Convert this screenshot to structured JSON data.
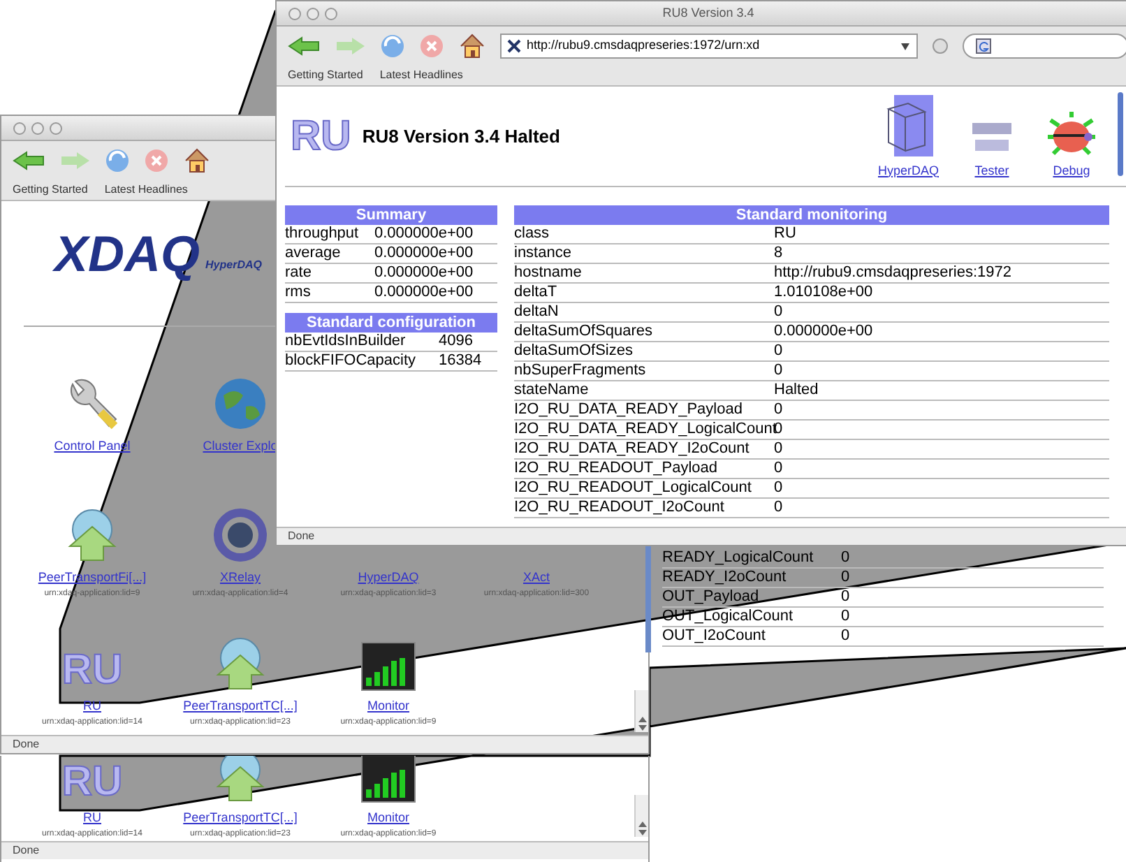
{
  "back_window": {
    "bookmarks": [
      "Getting Started",
      "Latest Headlines"
    ],
    "logo": "XDAQ",
    "logo_subtitle": "HyperDAQ",
    "application_rows": [
      [
        {
          "label": "Control Panel",
          "kind": "wrench"
        },
        {
          "label": "Cluster Explo",
          "kind": "globe"
        }
      ],
      [
        {
          "label": "PeerTransportFi[...]",
          "urn": "urn:xdaq-application:lid=9",
          "kind": "globe-arrow"
        },
        {
          "label": "XRelay",
          "urn": "urn:xdaq-application:lid=4",
          "kind": "ring"
        },
        {
          "label": "HyperDAQ",
          "urn": "urn:xdaq-application:lid=3",
          "kind": "hidden"
        },
        {
          "label": "XAct",
          "urn": "urn:xdaq-application:lid=300",
          "kind": "hidden"
        }
      ],
      [
        {
          "label": "RU",
          "urn": "urn:xdaq-application:lid=14",
          "kind": "ru",
          "icon_text": "RU"
        },
        {
          "label": "PeerTransportTC[...]",
          "urn": "urn:xdaq-application:lid=23",
          "kind": "globe-arrow"
        },
        {
          "label": "Monitor",
          "urn": "urn:xdaq-application:lid=9",
          "kind": "chart"
        }
      ]
    ],
    "status": "Done"
  },
  "lower_strip": {
    "applications": [
      {
        "label": "RU",
        "urn": "urn:xdaq-application:lid=14",
        "kind": "ru",
        "icon_text": "RU"
      },
      {
        "label": "PeerTransportTC[...]",
        "urn": "urn:xdaq-application:lid=23",
        "kind": "globe-arrow"
      },
      {
        "label": "Monitor",
        "urn": "urn:xdaq-application:lid=9",
        "kind": "chart"
      }
    ],
    "status": "Done"
  },
  "right_strip": {
    "rows": [
      {
        "name": "READY_LogicalCount",
        "value": "0"
      },
      {
        "name": "READY_I2oCount",
        "value": "0"
      },
      {
        "name": "OUT_Payload",
        "value": "0"
      },
      {
        "name": "OUT_LogicalCount",
        "value": "0"
      },
      {
        "name": "OUT_I2oCount",
        "value": "0"
      }
    ]
  },
  "front_window": {
    "title": "RU8 Version 3.4",
    "url": "http://rubu9.cmsdaqpreseries:1972/urn:xd",
    "bookmarks": [
      "Getting Started",
      "Latest Headlines"
    ],
    "logo": "RU",
    "heading": "RU8 Version 3.4 Halted",
    "tools": [
      {
        "label": "HyperDAQ",
        "kind": "cube"
      },
      {
        "label": "Tester",
        "kind": "tester"
      },
      {
        "label": "Debug",
        "kind": "bug"
      }
    ],
    "summary": {
      "title": "Summary",
      "rows": [
        {
          "name": "throughput",
          "value": "0.000000e+00"
        },
        {
          "name": "average",
          "value": "0.000000e+00"
        },
        {
          "name": "rate",
          "value": "0.000000e+00"
        },
        {
          "name": "rms",
          "value": "0.000000e+00"
        }
      ]
    },
    "configuration": {
      "title": "Standard configuration",
      "rows": [
        {
          "name": "nbEvtIdsInBuilder",
          "value": "4096"
        },
        {
          "name": "blockFIFOCapacity",
          "value": "16384"
        }
      ]
    },
    "monitoring": {
      "title": "Standard monitoring",
      "rows": [
        {
          "name": "class",
          "value": "RU"
        },
        {
          "name": "instance",
          "value": "8"
        },
        {
          "name": "hostname",
          "value": "http://rubu9.cmsdaqpreseries:1972"
        },
        {
          "name": "deltaT",
          "value": "1.010108e+00"
        },
        {
          "name": "deltaN",
          "value": "0"
        },
        {
          "name": "deltaSumOfSquares",
          "value": "0.000000e+00"
        },
        {
          "name": "deltaSumOfSizes",
          "value": "0"
        },
        {
          "name": "nbSuperFragments",
          "value": "0"
        },
        {
          "name": "stateName",
          "value": "Halted"
        },
        {
          "name": "I2O_RU_DATA_READY_Payload",
          "value": "0"
        },
        {
          "name": "I2O_RU_DATA_READY_LogicalCount",
          "value": "0"
        },
        {
          "name": "I2O_RU_DATA_READY_I2oCount",
          "value": "0"
        },
        {
          "name": "I2O_RU_READOUT_Payload",
          "value": "0"
        },
        {
          "name": "I2O_RU_READOUT_LogicalCount",
          "value": "0"
        },
        {
          "name": "I2O_RU_READOUT_I2oCount",
          "value": "0"
        }
      ]
    },
    "status": "Done"
  }
}
